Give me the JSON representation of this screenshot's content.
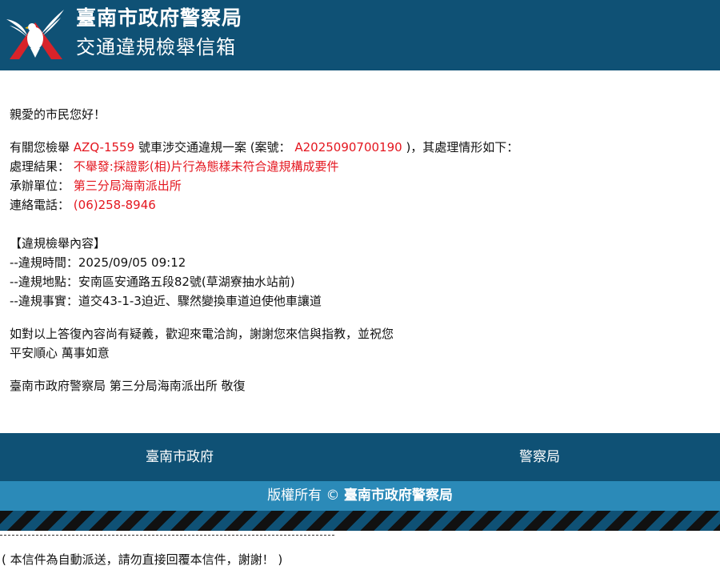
{
  "header": {
    "title": "臺南市政府警察局",
    "subtitle": "交通違規檢舉信箱"
  },
  "letter": {
    "greeting": "親愛的市民您好！",
    "intro_pre": "有關您檢舉",
    "plate": "AZQ-1559",
    "intro_mid": "號車涉交通違規一案 (案號：",
    "case_no": "A2025090700190",
    "intro_post": ")，其處理情形如下：",
    "result_label": "處理結果：",
    "result_value": "不舉發:採證影(相)片行為態樣未符合違規構成要件",
    "unit_label": "承辦單位：",
    "unit_value": "第三分局海南派出所",
    "phone_label": "連絡電話：",
    "phone_value": "(06)258-8946",
    "section_title": "【違規檢舉內容】",
    "detail_time": "--違規時間：2025/09/05 09:12",
    "detail_place": "--違規地點：安南區安通路五段82號(草湖寮抽水站前)",
    "detail_fact": "--違規事實：道交43-1-3迫近、驟然變換車道迫使他車讓道",
    "closing1": "如對以上答復內容尚有疑義，歡迎來電洽詢，謝謝您來信與指教，並祝您",
    "closing2": "平安順心 萬事如意",
    "signature": "臺南市政府警察局 第三分局海南派出所 敬復"
  },
  "nav": {
    "item1": "臺南市政府",
    "item2": "警察局"
  },
  "footer": {
    "copyright_prefix": "版權所有 © ",
    "copyright_org": "臺南市政府警察局",
    "auto_note": "( 本信件為自動派送，請勿直接回覆本信件，謝謝！ )"
  },
  "icons": {
    "logo": "police-eagle-emblem-icon"
  },
  "colors": {
    "header_bg": "#0f5175",
    "copyright_bg": "#2b8ab8",
    "highlight": "#e4161f"
  }
}
